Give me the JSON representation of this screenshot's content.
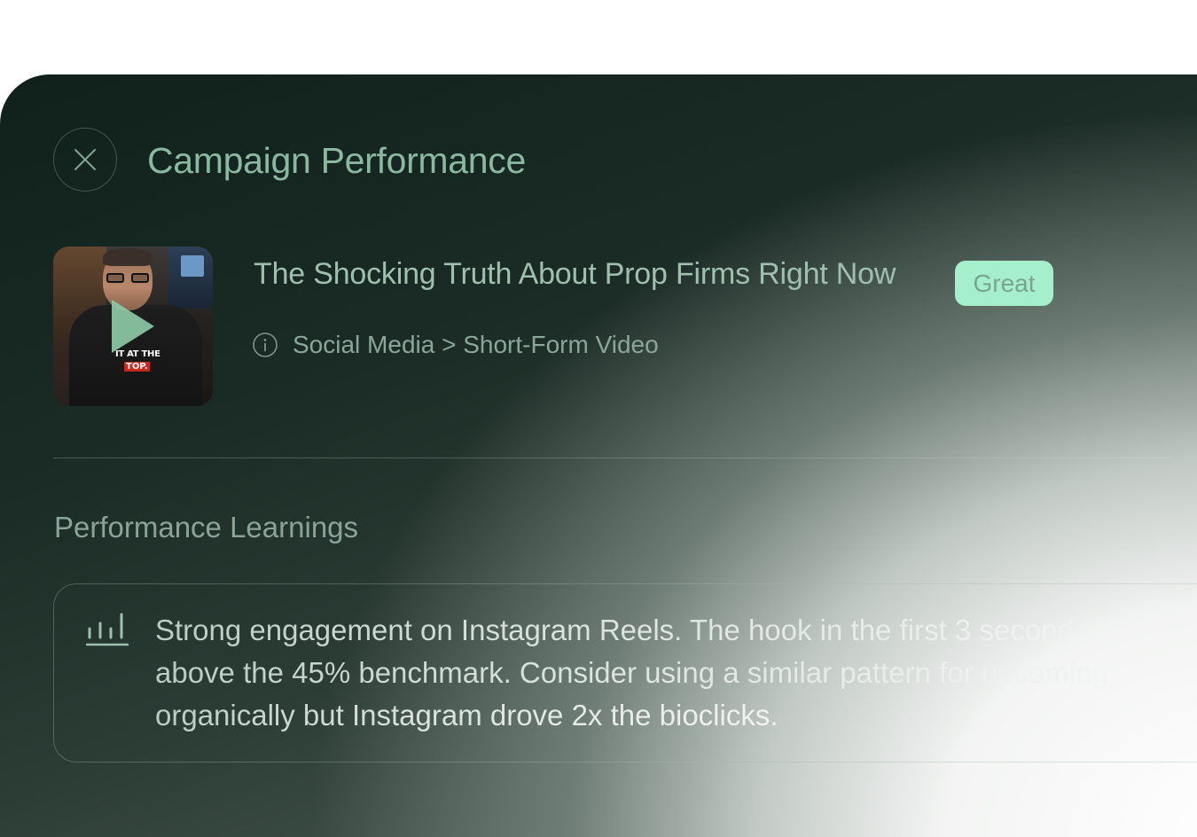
{
  "header": {
    "title": "Campaign Performance",
    "close_icon": "close-icon"
  },
  "campaign": {
    "video_title": "The Shocking Truth About Prop Firms Right Now",
    "rating_badge": "Great",
    "thumbnail_caption_line1": "IT AT THE",
    "thumbnail_caption_line2": "TOP.",
    "info_icon": "info-icon",
    "category_path": "Social Media > Short-Form Video"
  },
  "learnings": {
    "section_title": "Performance Learnings",
    "chart_icon": "bar-chart-icon",
    "lines": [
      "Strong engagement on Instagram Reels. The hook in the first 3 seconds o",
      "above the 45% benchmark. Consider using a similar pattern for upcoming",
      "organically but Instagram drove 2x the bioclicks."
    ]
  },
  "colors": {
    "accent_green": "#8ab9a1",
    "badge_bg": "#a6efcc",
    "badge_text": "#79a58e",
    "panel_dark": "#10201a"
  }
}
